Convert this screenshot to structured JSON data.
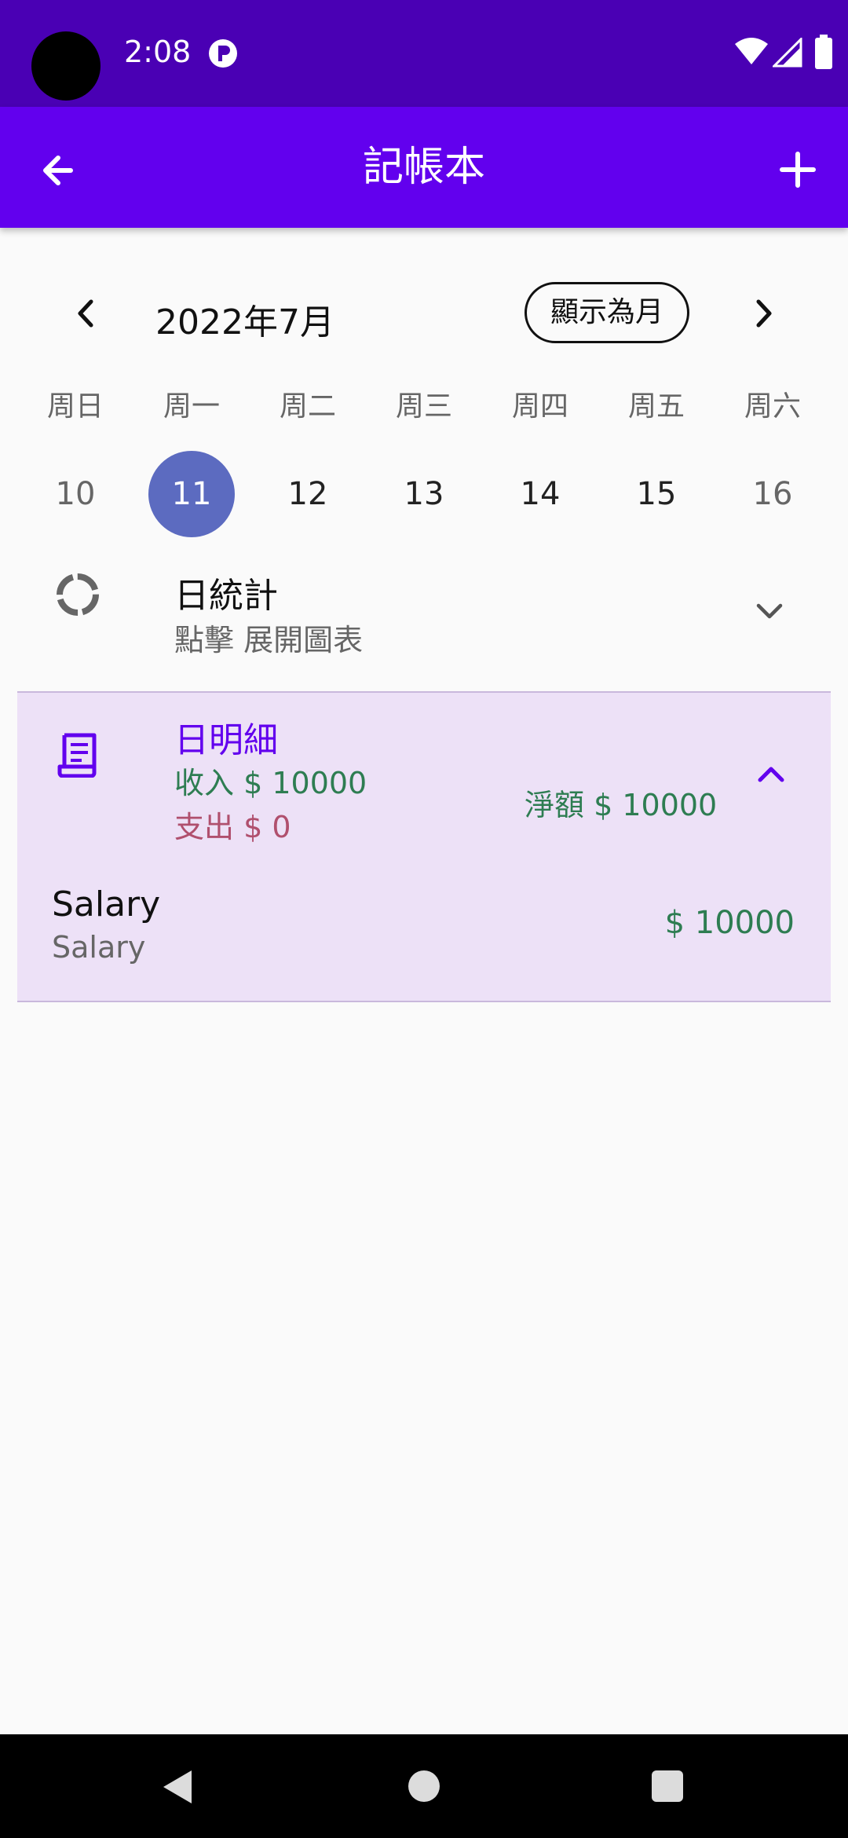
{
  "status_bar": {
    "time": "2:08"
  },
  "app_bar": {
    "title": "記帳本"
  },
  "calendar": {
    "month_label": "2022年7月",
    "toggle_label": "顯示為月",
    "days": [
      {
        "name": "周日",
        "num": "10"
      },
      {
        "name": "周一",
        "num": "11",
        "selected": true
      },
      {
        "name": "周二",
        "num": "12"
      },
      {
        "name": "周三",
        "num": "13"
      },
      {
        "name": "周四",
        "num": "14"
      },
      {
        "name": "周五",
        "num": "15"
      },
      {
        "name": "周六",
        "num": "16"
      }
    ]
  },
  "stats": {
    "title": "日統計",
    "subtitle": "點擊 展開圖表"
  },
  "details": {
    "title": "日明細",
    "income": "收入 $ 10000",
    "expense": "支出 $ 0",
    "net": "淨額 $ 10000",
    "transactions": [
      {
        "title": "Salary",
        "subtitle": "Salary",
        "amount": "$ 10000"
      }
    ]
  },
  "colors": {
    "status_bar": "#4a00b4",
    "app_bar": "#6200ee",
    "selected_day": "#5c6bc0",
    "detail_card": "#ede1f7",
    "income": "#2e7d52",
    "expense": "#b0506e"
  },
  "icons": {
    "back": "arrow-left-icon",
    "add": "plus-icon",
    "prev_month": "chevron-left-icon",
    "next_month": "chevron-right-icon",
    "stats": "donut-chart-icon",
    "stats_expand": "chevron-down-icon",
    "details": "receipt-icon",
    "details_collapse": "chevron-up-icon"
  }
}
